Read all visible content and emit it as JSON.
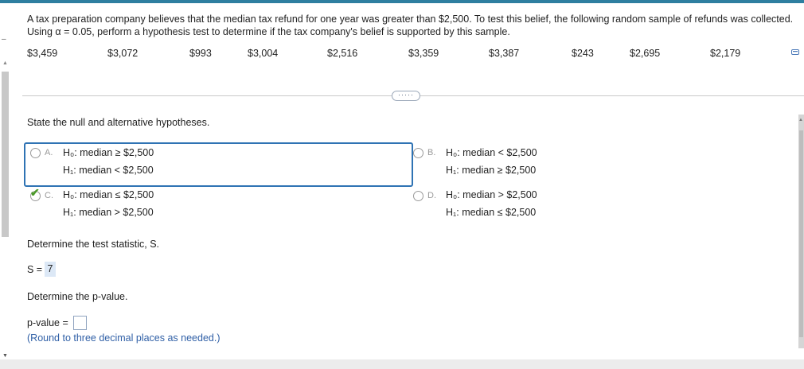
{
  "problem": {
    "text": "A tax preparation company believes that the median tax refund for one year was greater than $2,500. To test this belief, the following random sample of refunds was collected. Using α = 0.05, perform a hypothesis test to determine if the tax company's belief is supported by this sample.",
    "values": [
      "$3,459",
      "$3,072",
      "$993",
      "$3,004",
      "$2,516",
      "$3,359",
      "$3,387",
      "$243",
      "$2,695",
      "$2,179"
    ]
  },
  "more_button": "·····",
  "question1": {
    "prompt": "State the null and alternative hypotheses.",
    "options": [
      {
        "letter": "A.",
        "h0": "H₀: median ≥ $2,500",
        "h1": "H₁: median < $2,500"
      },
      {
        "letter": "B.",
        "h0": "H₀: median < $2,500",
        "h1": "H₁: median ≥ $2,500"
      },
      {
        "letter": "C.",
        "h0": "H₀: median ≤ $2,500",
        "h1": "H₁: median > $2,500",
        "selected": true
      },
      {
        "letter": "D.",
        "h0": "H₀: median > $2,500",
        "h1": "H₁: median ≤ $2,500"
      }
    ]
  },
  "question2": {
    "prompt": "Determine the test statistic, S.",
    "label": "S =",
    "answer": "7"
  },
  "question3": {
    "prompt": "Determine the p-value.",
    "label": "p-value =",
    "value": "",
    "hint": "(Round to three decimal places as needed.)"
  },
  "icons": {
    "expand": "expand-icon",
    "check": "checkmark-icon"
  },
  "colors": {
    "accent": "#2f73b4",
    "hint": "#2f5fa6",
    "correct": "#4c9a2a",
    "answer_bg": "#dce8f6"
  }
}
